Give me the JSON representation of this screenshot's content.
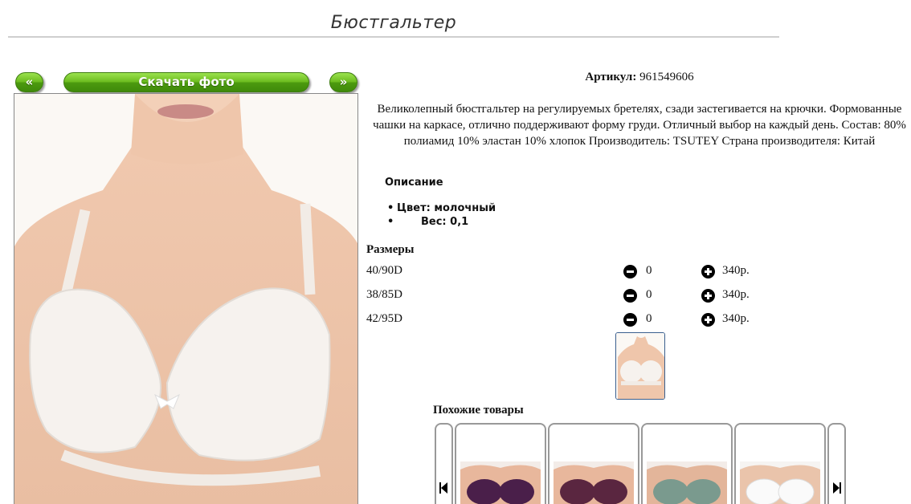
{
  "page": {
    "title": "Бюстгальтер"
  },
  "toolbar": {
    "prev_label": "«",
    "download_label": "Скачать фото",
    "next_label": "»"
  },
  "product": {
    "sku_label": "Артикул:",
    "sku_value": "961549606",
    "description": "Великолепный бюстгальтер на регулируемых бретелях, сзади застегивается на крючки. Формованные чашки на каркасе, отлично поддерживают форму груди. Отличный выбор на каждый день. Состав: 80% полиамид 10% эластан 10% хлопок Производитель: TSUTEY Страна производителя: Китай",
    "section_label": "Описание",
    "color_attr": "Цвет: молочный",
    "weight_attr": "Вес: 0,1"
  },
  "sizes": {
    "label": "Размеры",
    "rows": [
      {
        "name": "40/90D",
        "qty": "0",
        "price": "340р."
      },
      {
        "name": "38/85D",
        "qty": "0",
        "price": "340р."
      },
      {
        "name": "42/95D",
        "qty": "0",
        "price": "340р."
      }
    ]
  },
  "similar": {
    "label": "Похожие товары",
    "items": [
      {
        "icon": "purple-bra-photo",
        "color": "#4a1f4a"
      },
      {
        "icon": "plum-bra-photo",
        "color": "#5a2640"
      },
      {
        "icon": "sage-lace-bra-photo",
        "color": "#7a9a8e"
      },
      {
        "icon": "white-bra-photo",
        "color": "#f2f2f2"
      }
    ]
  },
  "colors": {
    "button_green": "#6cbc1f",
    "thumb_border": "#3a5f8e"
  }
}
